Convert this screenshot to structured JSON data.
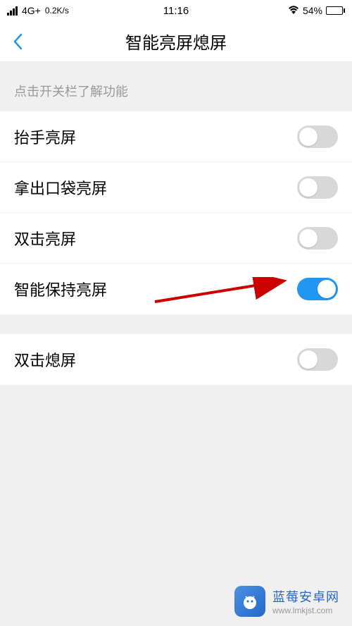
{
  "status": {
    "network": "4G+",
    "speed": "0.2K/s",
    "time": "11:16",
    "battery_pct": "54%",
    "battery_fill": 54
  },
  "header": {
    "title": "智能亮屏熄屏"
  },
  "hint": "点击开关栏了解功能",
  "group1": [
    {
      "label": "抬手亮屏",
      "on": false,
      "name": "raise-to-wake"
    },
    {
      "label": "拿出口袋亮屏",
      "on": false,
      "name": "pocket-wake"
    },
    {
      "label": "双击亮屏",
      "on": false,
      "name": "double-tap-wake"
    },
    {
      "label": "智能保持亮屏",
      "on": true,
      "name": "smart-stay"
    }
  ],
  "group2": [
    {
      "label": "双击熄屏",
      "on": false,
      "name": "double-tap-sleep"
    }
  ],
  "footer": {
    "title": "蓝莓安卓网",
    "url": "www.lmkjst.com"
  }
}
